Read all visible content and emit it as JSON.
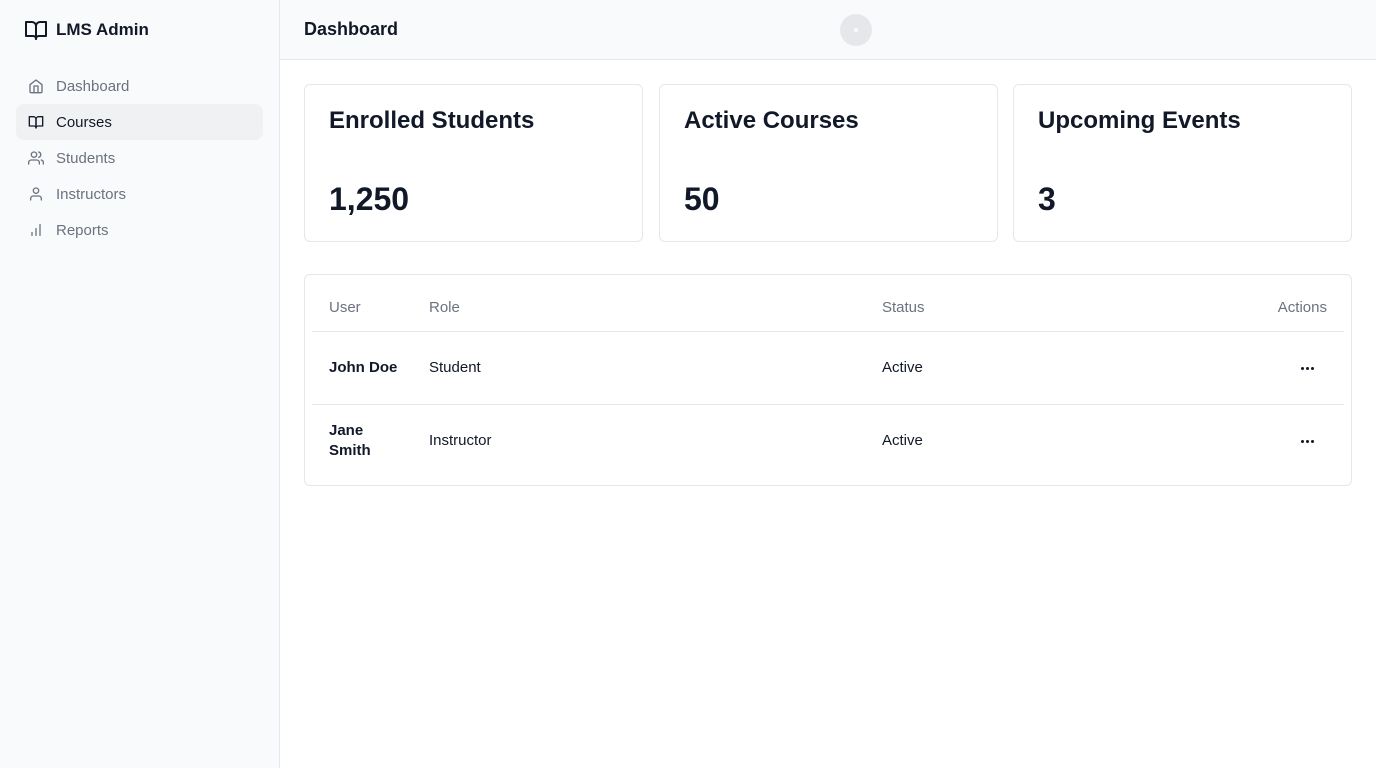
{
  "sidebar": {
    "brand": "LMS Admin",
    "items": [
      {
        "label": "Dashboard",
        "icon": "home-icon",
        "active": false
      },
      {
        "label": "Courses",
        "icon": "book-icon",
        "active": true
      },
      {
        "label": "Students",
        "icon": "users-icon",
        "active": false
      },
      {
        "label": "Instructors",
        "icon": "user-icon",
        "active": false
      },
      {
        "label": "Reports",
        "icon": "bar-chart-icon",
        "active": false
      }
    ]
  },
  "header": {
    "title": "Dashboard"
  },
  "stats": [
    {
      "title": "Enrolled Students",
      "value": "1,250"
    },
    {
      "title": "Active Courses",
      "value": "50"
    },
    {
      "title": "Upcoming Events",
      "value": "3"
    }
  ],
  "table": {
    "columns": [
      "User",
      "Role",
      "Status",
      "Actions"
    ],
    "rows": [
      {
        "user": "John Doe",
        "role": "Student",
        "status": "Active"
      },
      {
        "user": "Jane Smith",
        "role": "Instructor",
        "status": "Active"
      }
    ]
  },
  "colors": {
    "sidebar_bg": "#f9fafb",
    "active_bg": "#f0f1f3",
    "border": "#e5e7eb",
    "muted": "#6b7280",
    "text": "#111827"
  }
}
